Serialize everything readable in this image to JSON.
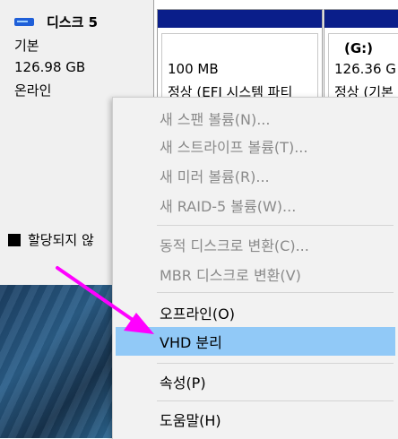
{
  "disk": {
    "name": "디스크 5",
    "type": "기본",
    "size": "126.98 GB",
    "status": "온라인"
  },
  "legend": {
    "unallocated_label": "할당되지 않"
  },
  "partitions": [
    {
      "size": "100 MB",
      "status": "정상 (EFI 시스템 파티"
    },
    {
      "letter": "(G:)",
      "size": "126.36 G",
      "status": "정상 (기본"
    }
  ],
  "menu": {
    "items": [
      {
        "label": "새 스팬 볼륨(N)...",
        "enabled": false
      },
      {
        "label": "새 스트라이프 볼륨(T)...",
        "enabled": false
      },
      {
        "label": "새 미러 볼륨(R)...",
        "enabled": false
      },
      {
        "label": "새 RAID-5 볼륨(W)...",
        "enabled": false
      },
      {
        "label": "동적 디스크로 변환(C)...",
        "enabled": false
      },
      {
        "label": "MBR 디스크로 변환(V)",
        "enabled": false
      },
      {
        "label": "오프라인(O)",
        "enabled": true
      },
      {
        "label": "VHD 분리",
        "enabled": true,
        "highlighted": true
      },
      {
        "label": "속성(P)",
        "enabled": true
      },
      {
        "label": "도움말(H)",
        "enabled": true
      }
    ]
  },
  "colors": {
    "partition_header": "#0a1e8a",
    "menu_highlight": "#91c9f7",
    "annotation_arrow": "#ff00ff"
  }
}
